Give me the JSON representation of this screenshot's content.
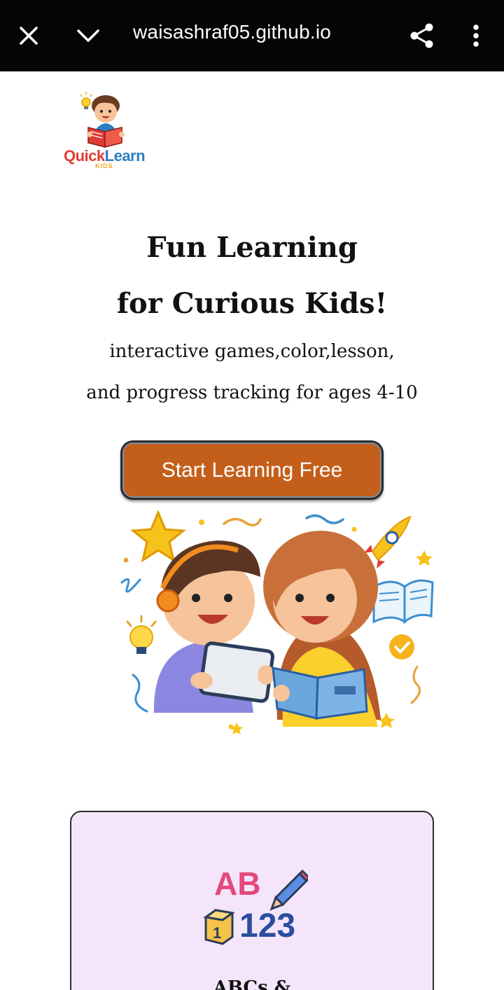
{
  "browser": {
    "url": "waisashraf05.github.io",
    "icons": [
      "close-icon",
      "chevron-down-icon",
      "share-icon",
      "more-vert-icon"
    ]
  },
  "logo": {
    "brand_part1": "Quick",
    "brand_part2": "Learn",
    "tagline": "KIDS"
  },
  "hero": {
    "title_line1": "Fun Learning",
    "title_line2": "for Curious Kids!",
    "subtitle_line1": "interactive games,color,lesson,",
    "subtitle_line2": "and progress tracking for ages 4-10",
    "cta_label": "Start Learning Free"
  },
  "card": {
    "icon_text_ab": "AB",
    "icon_text_123": "123",
    "block_digit": "1",
    "title": "ABCs &"
  },
  "colors": {
    "topbar": "#050505",
    "cta": "#c45f1b",
    "card_bg": "#f4e5fb",
    "brand_red": "#e03b34",
    "brand_blue": "#2a7fc2"
  }
}
